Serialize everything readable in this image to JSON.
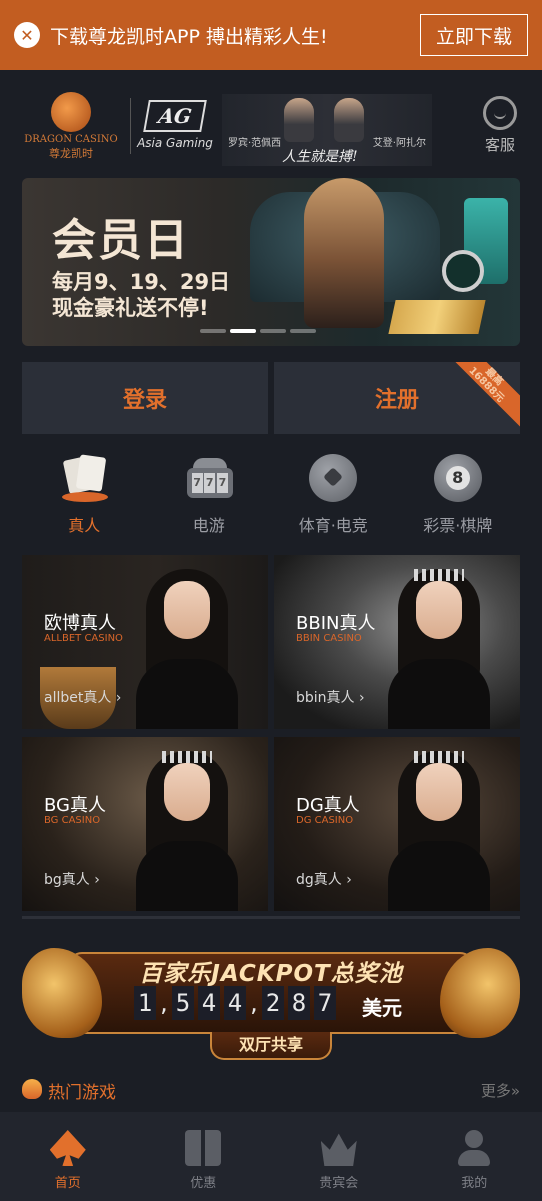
{
  "download_bar": {
    "text": "下载尊龙凯时APP 搏出精彩人生!",
    "button": "立即下载",
    "close_symbol": "✕",
    "background": "#c25d21"
  },
  "header": {
    "dragon_logo_en": "DRAGON CASINO",
    "dragon_logo_cn": "尊龙凯时",
    "ag_logo": "AG",
    "ag_sub": "Asia Gaming",
    "ambassador_left": "罗宾·范佩西",
    "ambassador_right": "艾登·阿扎尔",
    "slogan": "人生就是搏!",
    "service_label": "客服"
  },
  "banner": {
    "title": "会员日",
    "line1": "每月9、19、29日",
    "line2": "现金豪礼送不停!",
    "active_slide": 2,
    "slide_count": 4
  },
  "auth": {
    "login": "登录",
    "register": "注册",
    "ribbon_line1": "最高",
    "ribbon_line2": "16888元"
  },
  "categories": [
    {
      "label": "真人",
      "icon": "cards-icon",
      "active": true
    },
    {
      "label": "电游",
      "icon": "slot-machine-icon",
      "active": false
    },
    {
      "label": "体育·电竞",
      "icon": "soccer-ball-icon",
      "active": false
    },
    {
      "label": "彩票·棋牌",
      "icon": "eight-ball-icon",
      "active": false
    }
  ],
  "live_cards": [
    {
      "name": "欧博真人",
      "en": "ALLBET CASINO",
      "link": "allbet真人 ›"
    },
    {
      "name": "BBIN真人",
      "en": "BBIN CASINO",
      "link": "bbin真人 ›"
    },
    {
      "name": "BG真人",
      "en": "BG CASINO",
      "link": "bg真人 ›"
    },
    {
      "name": "DG真人",
      "en": "DG CASINO",
      "link": "dg真人 ›"
    }
  ],
  "jackpot": {
    "title": "百家乐JACKPOT总奖池",
    "digits": [
      "1",
      ",",
      "5",
      "4",
      "4",
      ",",
      "2",
      "8",
      "7"
    ],
    "unit": "美元",
    "tab": "双厅共享"
  },
  "hot_games": {
    "title": "热门游戏",
    "more": "更多»"
  },
  "bottom_nav": [
    {
      "label": "首页",
      "active": true
    },
    {
      "label": "优惠",
      "active": false
    },
    {
      "label": "贵宾会",
      "active": false
    },
    {
      "label": "我的",
      "active": false
    }
  ],
  "colors": {
    "accent": "#e2702c",
    "background": "#1b1e25",
    "panel": "#2b2f38"
  }
}
